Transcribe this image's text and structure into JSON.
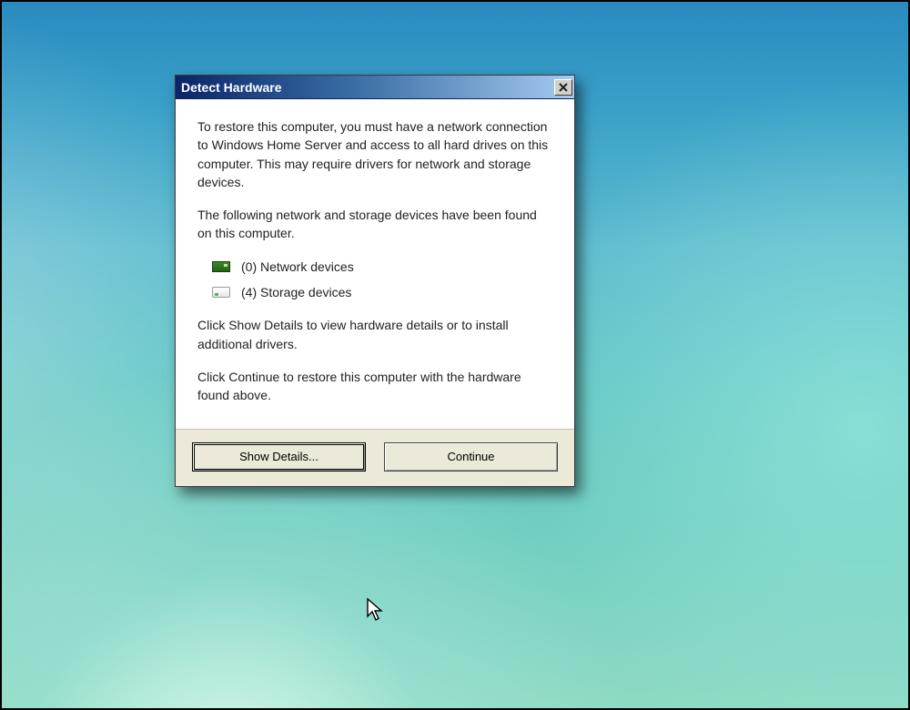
{
  "dialog": {
    "title": "Detect Hardware",
    "paragraph1": "To restore this computer, you must have a network connection to Windows Home Server and access to all hard drives on this computer. This may require drivers for network and storage devices.",
    "paragraph2": "The following network and storage devices have been found on this computer.",
    "network_devices_label": "(0) Network devices",
    "storage_devices_label": "(4) Storage devices",
    "paragraph3": "Click Show Details to view hardware details or to install additional drivers.",
    "paragraph4": "Click Continue to restore this computer with the hardware found above."
  },
  "buttons": {
    "show_details": "Show Details...",
    "continue": "Continue"
  }
}
